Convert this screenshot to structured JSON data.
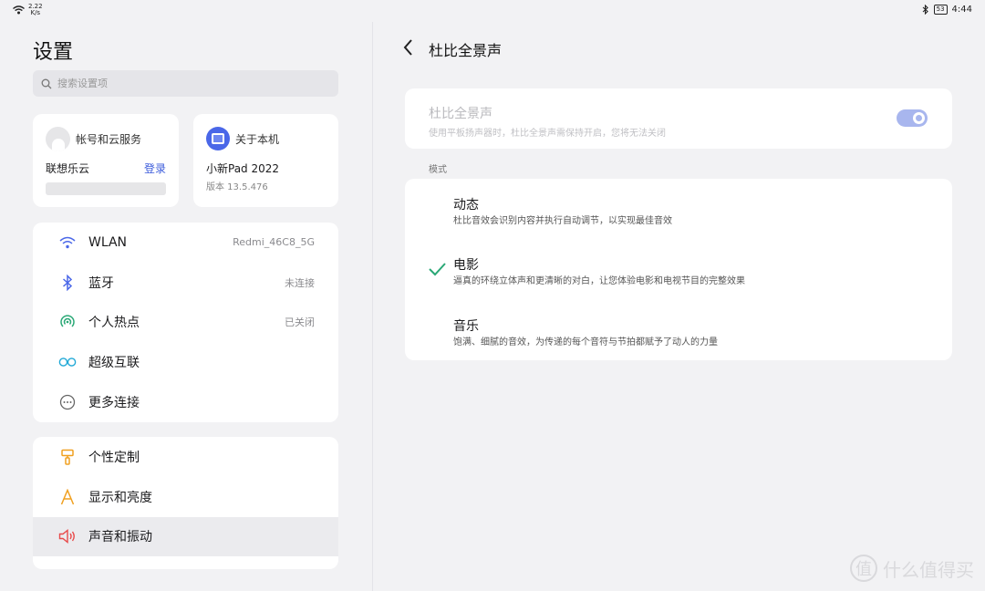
{
  "status_bar": {
    "speed_value": "2.22",
    "speed_unit": "K/s",
    "battery": "53",
    "time": "4:44"
  },
  "left": {
    "title": "设置",
    "search_placeholder": "搜索设置项",
    "account": {
      "label": "帐号和云服务",
      "name": "联想乐云",
      "login": "登录"
    },
    "about": {
      "label": "关于本机",
      "model": "小新Pad 2022",
      "version": "版本 13.5.476"
    },
    "connectivity": [
      {
        "label": "WLAN",
        "value": "Redmi_46C8_5G"
      },
      {
        "label": "蓝牙",
        "value": "未连接"
      },
      {
        "label": "个人热点",
        "value": "已关闭"
      },
      {
        "label": "超级互联",
        "value": ""
      },
      {
        "label": "更多连接",
        "value": ""
      }
    ],
    "personal": [
      {
        "label": "个性定制"
      },
      {
        "label": "显示和亮度"
      },
      {
        "label": "声音和振动"
      }
    ]
  },
  "right": {
    "title": "杜比全景声",
    "dolby": {
      "title": "杜比全景声",
      "subtitle": "使用平板扬声器时，杜比全景声需保持开启，您将无法关闭",
      "enabled": true
    },
    "mode_header": "模式",
    "modes": [
      {
        "title": "动态",
        "desc": "杜比音效会识别内容并执行自动调节，以实现最佳音效",
        "selected": false
      },
      {
        "title": "电影",
        "desc": "逼真的环绕立体声和更清晰的对白，让您体验电影和电视节目的完整效果",
        "selected": true
      },
      {
        "title": "音乐",
        "desc": "饱满、细腻的音效，为传递的每个音符与节拍都赋予了动人的力量",
        "selected": false
      }
    ]
  },
  "colors": {
    "accent": "#3b5bdb",
    "check": "#2aa876",
    "toggle": "#a8b6ee"
  },
  "watermark": {
    "badge": "值",
    "text": "什么值得买"
  }
}
